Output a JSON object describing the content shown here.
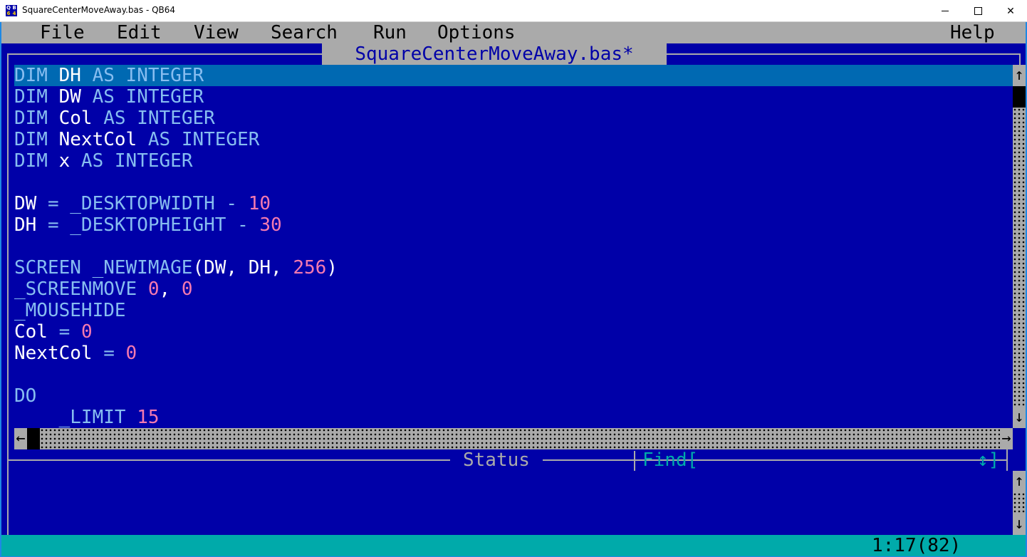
{
  "window": {
    "title": "SquareCenterMoveAway.bas - QB64",
    "icon": "qb64-app-icon",
    "icon_text": [
      "Q",
      "B",
      "6",
      "4"
    ],
    "controls": {
      "minimize": "minimize-icon",
      "maximize": "maximize-icon",
      "close": "close-icon",
      "close_glyph": "✕"
    }
  },
  "menu": {
    "items": [
      {
        "label": "File"
      },
      {
        "label": "Edit"
      },
      {
        "label": "View"
      },
      {
        "label": "Search"
      },
      {
        "label": "Run"
      },
      {
        "label": "Options"
      },
      {
        "label": "Help"
      }
    ]
  },
  "editor": {
    "file_title": "SquareCenterMoveAway.bas*",
    "current_line_index": 0,
    "lines": [
      [
        {
          "t": "DIM ",
          "c": "kw"
        },
        {
          "t": "DH",
          "c": "id"
        },
        {
          "t": " AS INTEGER",
          "c": "kw"
        }
      ],
      [
        {
          "t": "DIM ",
          "c": "kw"
        },
        {
          "t": "DW",
          "c": "id"
        },
        {
          "t": " AS INTEGER",
          "c": "kw"
        }
      ],
      [
        {
          "t": "DIM ",
          "c": "kw"
        },
        {
          "t": "Col",
          "c": "id"
        },
        {
          "t": " AS INTEGER",
          "c": "kw"
        }
      ],
      [
        {
          "t": "DIM ",
          "c": "kw"
        },
        {
          "t": "NextCol",
          "c": "id"
        },
        {
          "t": " AS INTEGER",
          "c": "kw"
        }
      ],
      [
        {
          "t": "DIM ",
          "c": "kw"
        },
        {
          "t": "x",
          "c": "id"
        },
        {
          "t": " AS INTEGER",
          "c": "kw"
        }
      ],
      [],
      [
        {
          "t": "DW",
          "c": "id"
        },
        {
          "t": " = ",
          "c": "op"
        },
        {
          "t": "_DESKTOPWIDTH",
          "c": "kw"
        },
        {
          "t": " - ",
          "c": "op"
        },
        {
          "t": "10",
          "c": "num"
        }
      ],
      [
        {
          "t": "DH",
          "c": "id"
        },
        {
          "t": " = ",
          "c": "op"
        },
        {
          "t": "_DESKTOPHEIGHT",
          "c": "kw"
        },
        {
          "t": " - ",
          "c": "op"
        },
        {
          "t": "30",
          "c": "num"
        }
      ],
      [],
      [
        {
          "t": "SCREEN _NEWIMAGE",
          "c": "kw"
        },
        {
          "t": "(DW, DH, ",
          "c": "id"
        },
        {
          "t": "256",
          "c": "num"
        },
        {
          "t": ")",
          "c": "id"
        }
      ],
      [
        {
          "t": "_SCREENMOVE ",
          "c": "kw"
        },
        {
          "t": "0",
          "c": "num"
        },
        {
          "t": ", ",
          "c": "id"
        },
        {
          "t": "0",
          "c": "num"
        }
      ],
      [
        {
          "t": "_MOUSEHIDE",
          "c": "kw"
        }
      ],
      [
        {
          "t": "Col",
          "c": "id"
        },
        {
          "t": " = ",
          "c": "op"
        },
        {
          "t": "0",
          "c": "num"
        }
      ],
      [
        {
          "t": "NextCol",
          "c": "id"
        },
        {
          "t": " = ",
          "c": "op"
        },
        {
          "t": "0",
          "c": "num"
        }
      ],
      [],
      [
        {
          "t": "DO",
          "c": "kw"
        }
      ],
      [
        {
          "t": "    _LIMIT ",
          "c": "kw"
        },
        {
          "t": "15",
          "c": "num"
        }
      ]
    ]
  },
  "scrollbars": {
    "vertical_up": "↑",
    "vertical_down": "↓",
    "horizontal_left": "←",
    "horizontal_right": "→"
  },
  "status_panel": {
    "label": "Status",
    "find_label": "Find[",
    "find_end": "↕]"
  },
  "statusbar": {
    "cursor_position": "1:17(82)"
  },
  "colors": {
    "background": "#0000a8",
    "menu_bg": "#aaaaaa",
    "current_line": "#0069b2",
    "keyword": "#87bdf0",
    "identifier": "#ffffff",
    "number": "#f57ab0",
    "find_text": "#00aaaa",
    "statusbar_bg": "#00aaaa"
  }
}
